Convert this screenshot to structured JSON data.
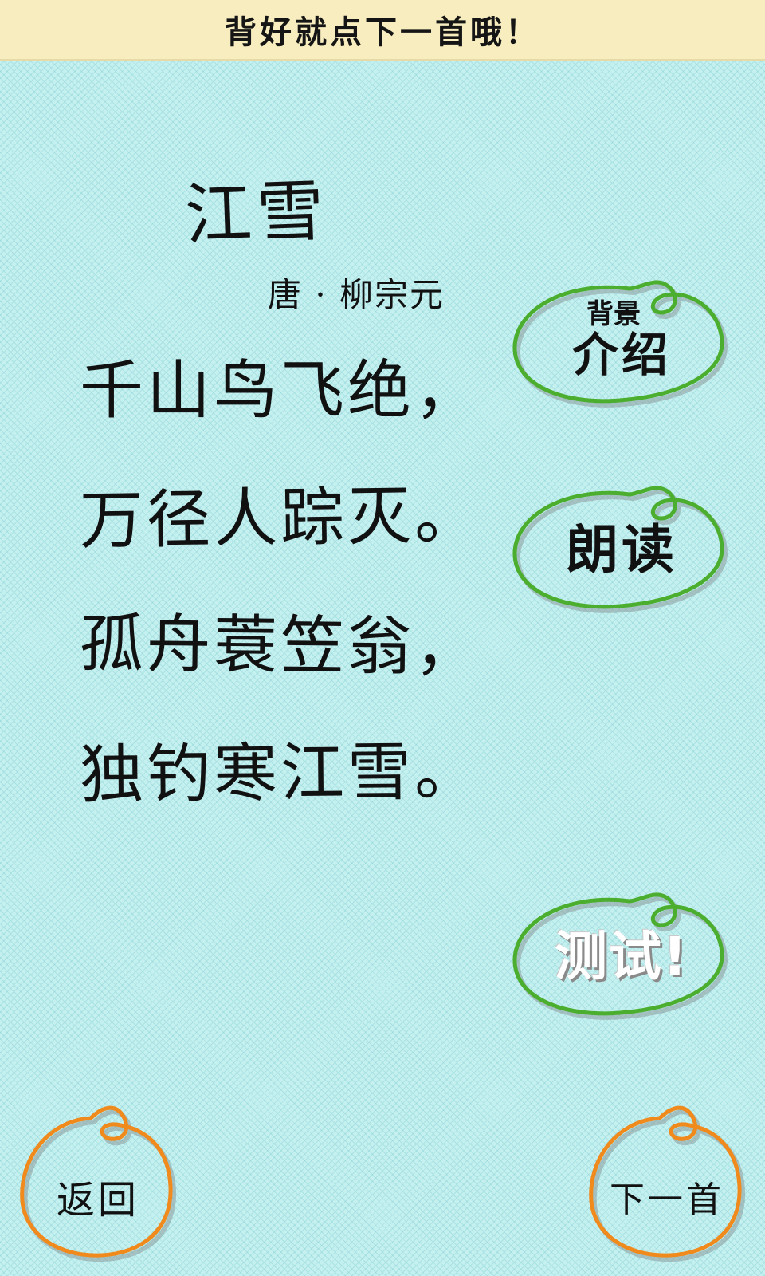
{
  "banner": {
    "text": "背好就点下一首哦！"
  },
  "poem": {
    "title": "江雪",
    "author": "唐 · 柳宗元",
    "lines": [
      "千山鸟飞绝，",
      "万径人踪灭。",
      "孤舟蓑笠翁，",
      "独钓寒江雪。"
    ]
  },
  "buttons": {
    "background_small": "背景",
    "background_big": "介绍",
    "read": "朗读",
    "test": "测试!",
    "back": "返回",
    "next": "下一首"
  },
  "colors": {
    "page_background": "#c5f0f0",
    "banner_background": "#f7edbf",
    "green_loop": "#4cae2e",
    "orange_loop": "#f08a1c",
    "text": "#111111"
  },
  "icons": {
    "green_loop": "loop-circle-icon",
    "orange_loop": "loop-circle-icon"
  }
}
